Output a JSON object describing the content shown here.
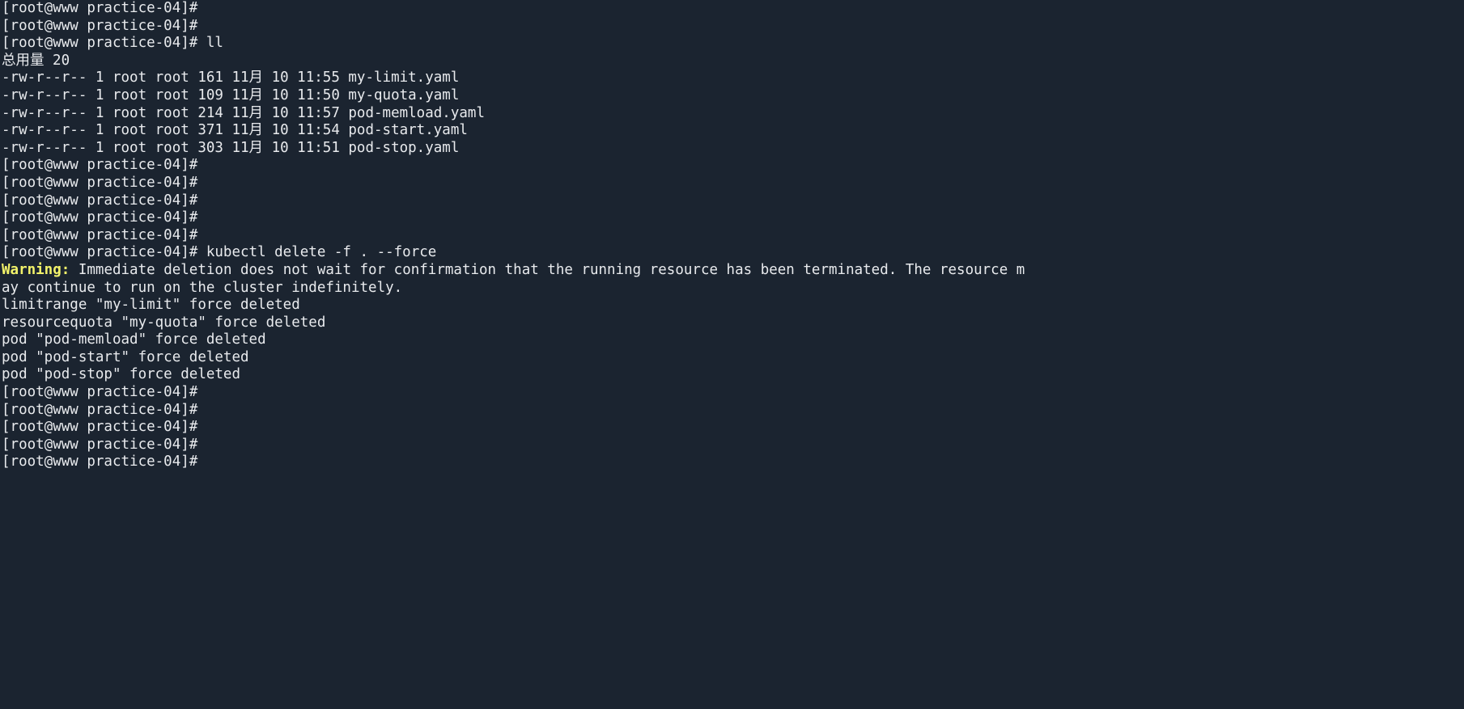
{
  "terminal": {
    "colors": {
      "background": "#1b2430",
      "foreground": "#e8eaed",
      "warning": "#f2f26a"
    },
    "prompt": "[root@www practice-04]#",
    "lines": [
      {
        "id": "l01",
        "text": "[root@www practice-04]#",
        "color": "default"
      },
      {
        "id": "l02",
        "text": "[root@www practice-04]#",
        "color": "default"
      },
      {
        "id": "l03",
        "text": "[root@www practice-04]# ll",
        "color": "default"
      },
      {
        "id": "l04",
        "text": "总用量 20",
        "color": "default"
      },
      {
        "id": "l05",
        "text": "-rw-r--r-- 1 root root 161 11月 10 11:55 my-limit.yaml",
        "color": "default"
      },
      {
        "id": "l06",
        "text": "-rw-r--r-- 1 root root 109 11月 10 11:50 my-quota.yaml",
        "color": "default"
      },
      {
        "id": "l07",
        "text": "-rw-r--r-- 1 root root 214 11月 10 11:57 pod-memload.yaml",
        "color": "default"
      },
      {
        "id": "l08",
        "text": "-rw-r--r-- 1 root root 371 11月 10 11:54 pod-start.yaml",
        "color": "default"
      },
      {
        "id": "l09",
        "text": "-rw-r--r-- 1 root root 303 11月 10 11:51 pod-stop.yaml",
        "color": "default"
      },
      {
        "id": "l10",
        "text": "[root@www practice-04]#",
        "color": "default"
      },
      {
        "id": "l11",
        "text": "[root@www practice-04]#",
        "color": "default"
      },
      {
        "id": "l12",
        "text": "[root@www practice-04]#",
        "color": "default"
      },
      {
        "id": "l13",
        "text": "[root@www practice-04]#",
        "color": "default"
      },
      {
        "id": "l14",
        "text": "[root@www practice-04]#",
        "color": "default"
      },
      {
        "id": "l15",
        "text": "[root@www practice-04]# kubectl delete -f . --force",
        "color": "default"
      },
      {
        "id": "l16",
        "warning_label": "Warning:",
        "text": " Immediate deletion does not wait for confirmation that the running resource has been terminated. The resource m",
        "color": "split-warning"
      },
      {
        "id": "l17",
        "text": "ay continue to run on the cluster indefinitely.",
        "color": "default"
      },
      {
        "id": "l18",
        "text": "limitrange \"my-limit\" force deleted",
        "color": "default"
      },
      {
        "id": "l19",
        "text": "resourcequota \"my-quota\" force deleted",
        "color": "default"
      },
      {
        "id": "l20",
        "text": "pod \"pod-memload\" force deleted",
        "color": "default"
      },
      {
        "id": "l21",
        "text": "pod \"pod-start\" force deleted",
        "color": "default"
      },
      {
        "id": "l22",
        "text": "pod \"pod-stop\" force deleted",
        "color": "default"
      },
      {
        "id": "l23",
        "text": "[root@www practice-04]#",
        "color": "default"
      },
      {
        "id": "l24",
        "text": "[root@www practice-04]#",
        "color": "default"
      },
      {
        "id": "l25",
        "text": "[root@www practice-04]#",
        "color": "default"
      },
      {
        "id": "l26",
        "text": "[root@www practice-04]#",
        "color": "default"
      },
      {
        "id": "l27",
        "text": "[root@www practice-04]#",
        "color": "default"
      }
    ],
    "file_listing": {
      "total_label": "总用量",
      "total_blocks": "20",
      "columns": [
        "permissions",
        "links",
        "owner",
        "group",
        "size",
        "month",
        "day",
        "time",
        "name"
      ],
      "rows": [
        {
          "permissions": "-rw-r--r--",
          "links": "1",
          "owner": "root",
          "group": "root",
          "size": "161",
          "month": "11月",
          "day": "10",
          "time": "11:55",
          "name": "my-limit.yaml"
        },
        {
          "permissions": "-rw-r--r--",
          "links": "1",
          "owner": "root",
          "group": "root",
          "size": "109",
          "month": "11月",
          "day": "10",
          "time": "11:50",
          "name": "my-quota.yaml"
        },
        {
          "permissions": "-rw-r--r--",
          "links": "1",
          "owner": "root",
          "group": "root",
          "size": "214",
          "month": "11月",
          "day": "10",
          "time": "11:57",
          "name": "pod-memload.yaml"
        },
        {
          "permissions": "-rw-r--r--",
          "links": "1",
          "owner": "root",
          "group": "root",
          "size": "371",
          "month": "11月",
          "day": "10",
          "time": "11:54",
          "name": "pod-start.yaml"
        },
        {
          "permissions": "-rw-r--r--",
          "links": "1",
          "owner": "root",
          "group": "root",
          "size": "303",
          "month": "11月",
          "day": "10",
          "time": "11:51",
          "name": "pod-stop.yaml"
        }
      ]
    },
    "commands": [
      "ll",
      "kubectl delete -f . --force"
    ],
    "deleted_resources": [
      {
        "kind": "limitrange",
        "name": "my-limit",
        "status": "force deleted"
      },
      {
        "kind": "resourcequota",
        "name": "my-quota",
        "status": "force deleted"
      },
      {
        "kind": "pod",
        "name": "pod-memload",
        "status": "force deleted"
      },
      {
        "kind": "pod",
        "name": "pod-start",
        "status": "force deleted"
      },
      {
        "kind": "pod",
        "name": "pod-stop",
        "status": "force deleted"
      }
    ]
  }
}
